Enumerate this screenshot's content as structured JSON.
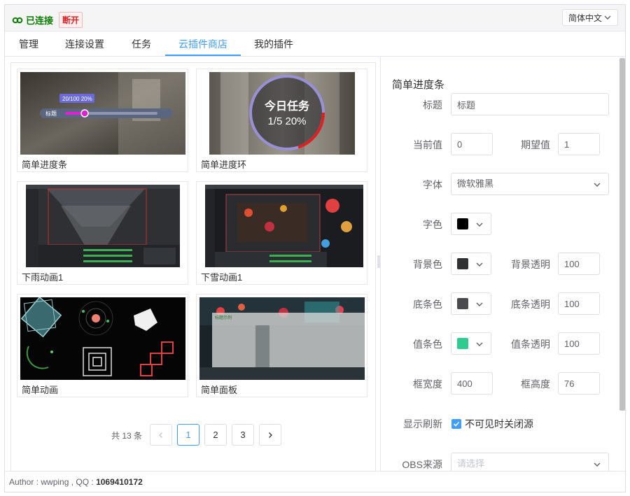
{
  "header": {
    "status_text": "已连接",
    "disconnect_label": "断开",
    "language": "简体中文",
    "status_color": "#0a7d00",
    "disconnect_color": "#e02020"
  },
  "tabs": [
    {
      "label": "管理"
    },
    {
      "label": "连接设置"
    },
    {
      "label": "任务"
    },
    {
      "label": "云插件商店",
      "active": true
    },
    {
      "label": "我的插件"
    }
  ],
  "plugins": [
    {
      "name": "简单进度条",
      "thumb": "progress-bar",
      "overlay_label": "标题",
      "overlay_value": "20/100 20%"
    },
    {
      "name": "简单进度环",
      "thumb": "progress-ring",
      "overlay_title": "今日任务",
      "overlay_value": "1/5 20%"
    },
    {
      "name": "下雨动画1",
      "thumb": "rain"
    },
    {
      "name": "下雪动画1",
      "thumb": "snow"
    },
    {
      "name": "简单动画",
      "thumb": "shapes"
    },
    {
      "name": "简单面板",
      "thumb": "panel",
      "overlay_label": "标题示例"
    }
  ],
  "pagination": {
    "total_text": "共 13 条",
    "pages": [
      "1",
      "2",
      "3"
    ],
    "current": "1"
  },
  "form": {
    "title": "简单进度条",
    "labels": {
      "title": "标题",
      "current": "当前值",
      "expected": "期望值",
      "font": "字体",
      "font_color": "字色",
      "bg_color": "背景色",
      "bg_alpha": "背景透明",
      "bar_color": "底条色",
      "bar_alpha": "底条透明",
      "value_color": "值条色",
      "value_alpha": "值条透明",
      "width": "框宽度",
      "height": "框高度",
      "refresh": "显示刷新",
      "obs_source": "OBS来源"
    },
    "values": {
      "title": "标题",
      "current": "0",
      "expected": "1",
      "font": "微软雅黑",
      "bg_alpha": "100",
      "bar_alpha": "100",
      "value_alpha": "100",
      "width": "400",
      "height": "76"
    },
    "colors": {
      "font_color": "#000000",
      "bg_color": "#303133",
      "bar_color": "#4a4a4f",
      "value_color": "#2ecc8f"
    },
    "refresh_checkbox": {
      "label": "不可见时关闭源",
      "checked": true
    },
    "obs_source_placeholder": "请选择"
  },
  "footer": {
    "author_prefix": "Author : wwping , QQ : ",
    "qq": "1069410172"
  },
  "accent_color": "#409eff"
}
